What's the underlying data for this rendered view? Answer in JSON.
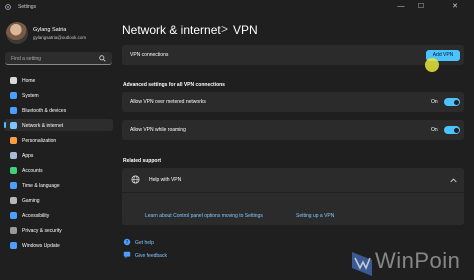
{
  "window": {
    "title": "Settings",
    "controls": [
      "—",
      "☐",
      "✕"
    ]
  },
  "user": {
    "name": "Gylang Satria",
    "email": "gylangsatria@outlook.com"
  },
  "search": {
    "placeholder": "Find a setting"
  },
  "sidebar": {
    "items": [
      {
        "label": "Home",
        "icon": "home-icon",
        "color": "#d9d9d9"
      },
      {
        "label": "System",
        "icon": "system-icon",
        "color": "#4c9eff"
      },
      {
        "label": "Bluetooth & devices",
        "icon": "bluetooth-icon",
        "color": "#4c9eff"
      },
      {
        "label": "Network & internet",
        "icon": "network-icon",
        "color": "#7cc4ff"
      },
      {
        "label": "Personalization",
        "icon": "personalization-icon",
        "color": "#ff9f3f"
      },
      {
        "label": "Apps",
        "icon": "apps-icon",
        "color": "#a9b9d9"
      },
      {
        "label": "Accounts",
        "icon": "accounts-icon",
        "color": "#3fd07a"
      },
      {
        "label": "Time & language",
        "icon": "time-language-icon",
        "color": "#4c9eff"
      },
      {
        "label": "Gaming",
        "icon": "gaming-icon",
        "color": "#b8b8b8"
      },
      {
        "label": "Accessibility",
        "icon": "accessibility-icon",
        "color": "#4c9eff"
      },
      {
        "label": "Privacy & security",
        "icon": "privacy-icon",
        "color": "#9a9a9a"
      },
      {
        "label": "Windows Update",
        "icon": "windows-update-icon",
        "color": "#4c9eff"
      }
    ],
    "active_index": 3
  },
  "breadcrumb": {
    "parent": "Network & internet",
    "separator": ">",
    "current": "VPN"
  },
  "vpn": {
    "connections_label": "VPN connections",
    "add_button": "Add VPN"
  },
  "advanced": {
    "title": "Advanced settings for all VPN connections",
    "metered": {
      "label": "Allow VPN over metered networks",
      "state": "On",
      "on": true
    },
    "roaming": {
      "label": "Allow VPN while roaming",
      "state": "On",
      "on": true
    }
  },
  "related": {
    "title": "Related support",
    "help_label": "Help with VPN",
    "links": [
      "Learn about Control panel options moving to Settings",
      "Setting up a VPN"
    ]
  },
  "footer": {
    "get_help": "Get help",
    "give_feedback": "Give feedback"
  },
  "watermark": {
    "text": "WinPoin"
  },
  "colors": {
    "accent": "#4cc2ff",
    "background": "#1f1f1f",
    "card": "#2b2b2b"
  }
}
